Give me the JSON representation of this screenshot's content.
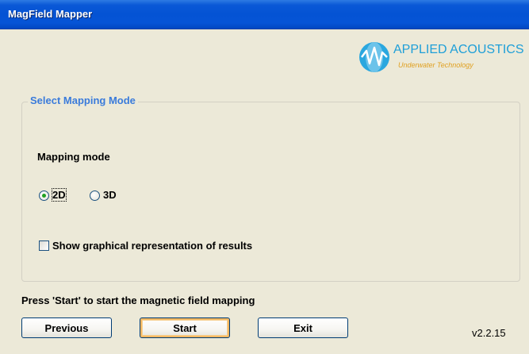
{
  "window": {
    "title": "MagField Mapper"
  },
  "logo": {
    "brand": "APPLIED ACOUSTICS",
    "tagline": "Underwater Technology"
  },
  "group": {
    "legend": "Select Mapping Mode"
  },
  "mapping_mode": {
    "label": "Mapping mode",
    "options": [
      {
        "label": "2D",
        "selected": true
      },
      {
        "label": "3D",
        "selected": false
      }
    ]
  },
  "graphical": {
    "label": "Show graphical representation of results",
    "checked": false
  },
  "status": {
    "text": "Press 'Start' to start the magnetic field mapping"
  },
  "buttons": {
    "previous": "Previous",
    "start": "Start",
    "exit": "Exit"
  },
  "version": "v2.2.15",
  "colors": {
    "accent": "#3A7BDB",
    "titlebar": "#0453D4",
    "radio_dot": "#21A121",
    "logo_blue": "#1E9FD8",
    "logo_orange": "#E0A020"
  },
  "icons": {
    "logo_mark": "applied-acoustics-logo-icon"
  }
}
